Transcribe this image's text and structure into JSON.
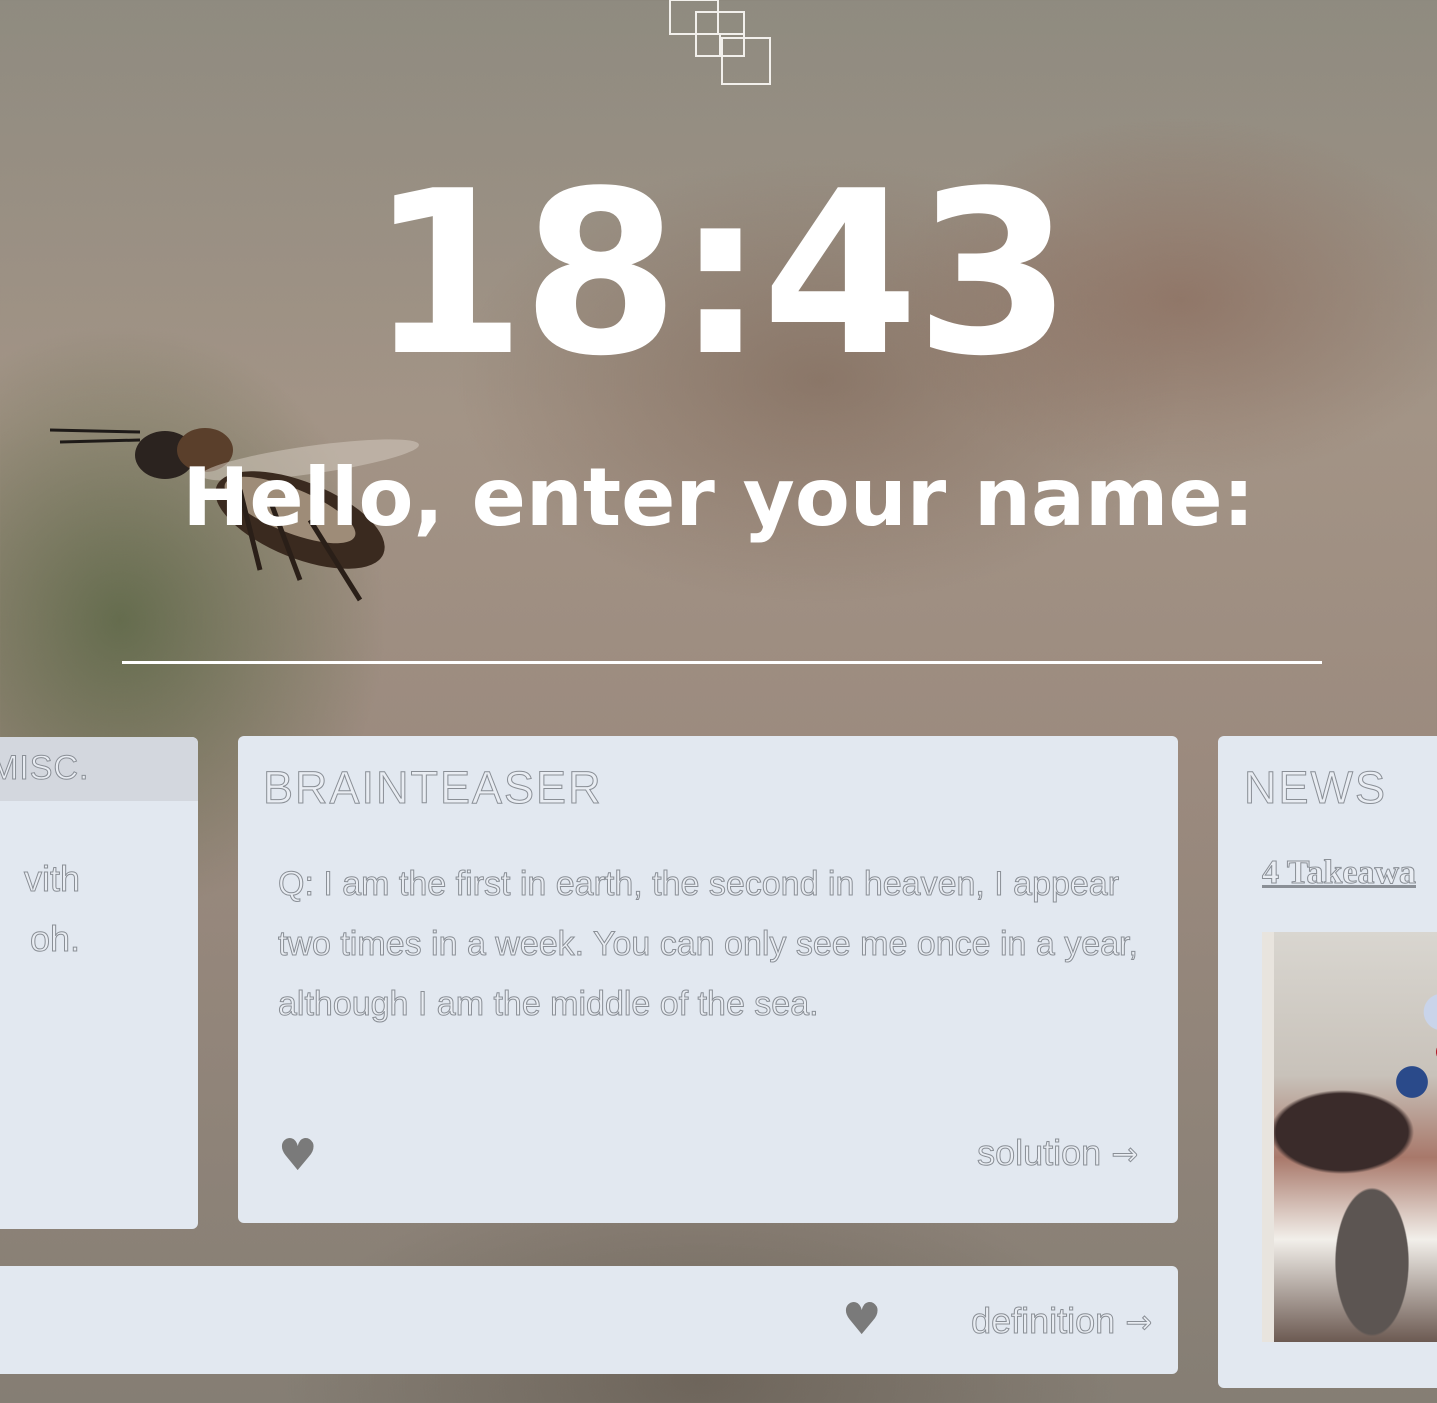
{
  "clock": {
    "time": "18:43"
  },
  "greeting": {
    "prompt": "Hello, enter your name:"
  },
  "cards": {
    "misc": {
      "title": "MISC.",
      "text_lines": [
        "vith",
        "oh."
      ]
    },
    "brainteaser": {
      "title": "BRAINTEASER",
      "question": "Q: I am the first in earth, the second in heaven, I appear two times in a week. You can only see me once in a year, although I am the middle of the sea.",
      "favorite_icon": "heart-icon",
      "action_label": "solution",
      "action_arrow": "→"
    },
    "word": {
      "favorite_icon": "heart-icon",
      "action_label": "definition",
      "action_arrow": "→"
    },
    "news": {
      "title": "NEWS",
      "headline": "4 Takeawa"
    }
  },
  "colors": {
    "card_background": "#e2e8f0",
    "heart": "#7a7a7a",
    "text_outline": "#8a8f96"
  }
}
